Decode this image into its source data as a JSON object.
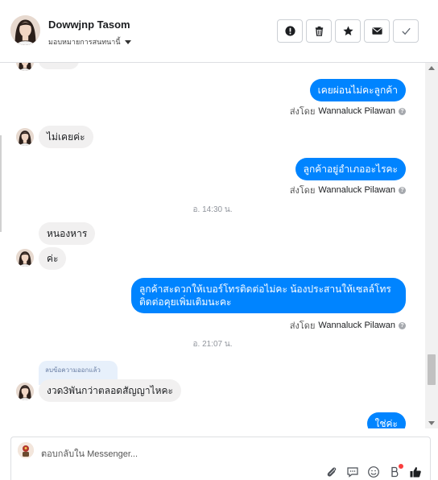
{
  "header": {
    "contact_name": "Dowwjnp Tasom",
    "assign_label": "มอบหมายการสนทนานี้",
    "actions": [
      {
        "name": "report-button",
        "icon": "exclamation-icon"
      },
      {
        "name": "delete-button",
        "icon": "trash-icon"
      },
      {
        "name": "star-button",
        "icon": "star-icon"
      },
      {
        "name": "mail-button",
        "icon": "envelope-icon"
      },
      {
        "name": "done-button",
        "icon": "checkmark-icon"
      }
    ]
  },
  "conversation": {
    "messages": [
      {
        "id": "m1",
        "direction": "out",
        "text": "เคยผ่อนไม่คะลูกค้า",
        "sender_prefix": "ส่งโดย",
        "sender_name": "Wannaluck Pilawan"
      },
      {
        "id": "m2",
        "direction": "in",
        "text": "ไม่เคยค่ะ"
      },
      {
        "id": "m3",
        "direction": "out",
        "text": "ลูกค้าอยู่อำเภออะไรคะ",
        "sender_prefix": "ส่งโดย",
        "sender_name": "Wannaluck Pilawan"
      },
      {
        "id": "t1",
        "type": "timestamp",
        "text": "อ. 14:30 น."
      },
      {
        "id": "m4",
        "direction": "in",
        "text": "หนองหาร"
      },
      {
        "id": "m5",
        "direction": "in",
        "text": "ค่ะ"
      },
      {
        "id": "m6",
        "direction": "out",
        "text": "ลูกค้าสะดวกให้เบอร์โทรติดต่อไม่คะ น้องประสานให้เซลล์โทรติดต่อคุยเพิ่มเติมนะคะ",
        "sender_prefix": "ส่งโดย",
        "sender_name": "Wannaluck Pilawan"
      },
      {
        "id": "t2",
        "type": "timestamp",
        "text": "อ. 21:07 น."
      },
      {
        "id": "m7",
        "direction": "in",
        "text": "งวด3พันกว่าตลอดสัญญาไหคะ",
        "deleted_note": "ลบข้อความออกแล้ว"
      },
      {
        "id": "m8",
        "direction": "out",
        "text": "ใช่ค่ะ"
      }
    ]
  },
  "composer": {
    "placeholder": "ตอบกลับใน Messenger...",
    "tools": [
      "paperclip-icon",
      "comment-icon",
      "emoji-icon",
      "bot-icon",
      "thumbs-up-icon"
    ]
  },
  "colors": {
    "outgoing_bubble": "#0084ff",
    "incoming_bubble": "#f1f0f0",
    "like_button": "#0084ff"
  }
}
